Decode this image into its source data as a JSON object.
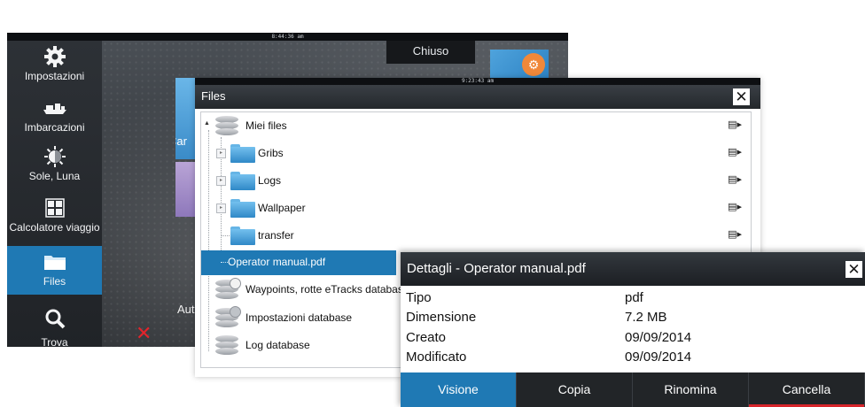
{
  "device": {
    "clock": "8:44:36 am",
    "sidebar": [
      {
        "label": "Impostazioni",
        "icon": "gear-icon"
      },
      {
        "label": "Imbarcazioni",
        "icon": "vessels-icon"
      },
      {
        "label": "Sole, Luna",
        "icon": "sun-moon-icon"
      },
      {
        "label": "Calcolatore viaggio",
        "icon": "calculator-icon"
      },
      {
        "label": "Files",
        "icon": "folder-icon"
      },
      {
        "label": "Trova",
        "icon": "search-icon"
      }
    ],
    "chiuso": "Chiuso",
    "tile_car_label": "Car",
    "aut_label": "Aut"
  },
  "files": {
    "clock": "9:23:43 am",
    "title": "Files",
    "close_icon": "close-icon",
    "tree": [
      {
        "name": "Miei files",
        "type": "database",
        "level": 0
      },
      {
        "name": "Gribs",
        "type": "folder",
        "level": 1
      },
      {
        "name": "Logs",
        "type": "folder",
        "level": 1
      },
      {
        "name": "Wallpaper",
        "type": "folder",
        "level": 1
      },
      {
        "name": "transfer",
        "type": "folder",
        "level": 1
      },
      {
        "name": "Operator manual.pdf",
        "type": "file",
        "level": 1,
        "selected": true
      },
      {
        "name": "Waypoints, rotte eTracks database",
        "type": "database",
        "level": 0
      },
      {
        "name": "Impostazioni database",
        "type": "database",
        "level": 0
      },
      {
        "name": "Log database",
        "type": "database",
        "level": 0
      }
    ]
  },
  "details": {
    "title": "Dettagli - Operator manual.pdf",
    "properties": [
      {
        "key": "Tipo",
        "value": "pdf"
      },
      {
        "key": "Dimensione",
        "value": "7.2 MB"
      },
      {
        "key": "Creato",
        "value": "09/09/2014"
      },
      {
        "key": "Modificato",
        "value": "09/09/2014"
      }
    ],
    "buttons": {
      "view": "Visione",
      "copy": "Copia",
      "rename": "Rinomina",
      "delete": "Cancella"
    }
  },
  "colors": {
    "accent": "#1f79b4",
    "danger": "#d7252b"
  }
}
